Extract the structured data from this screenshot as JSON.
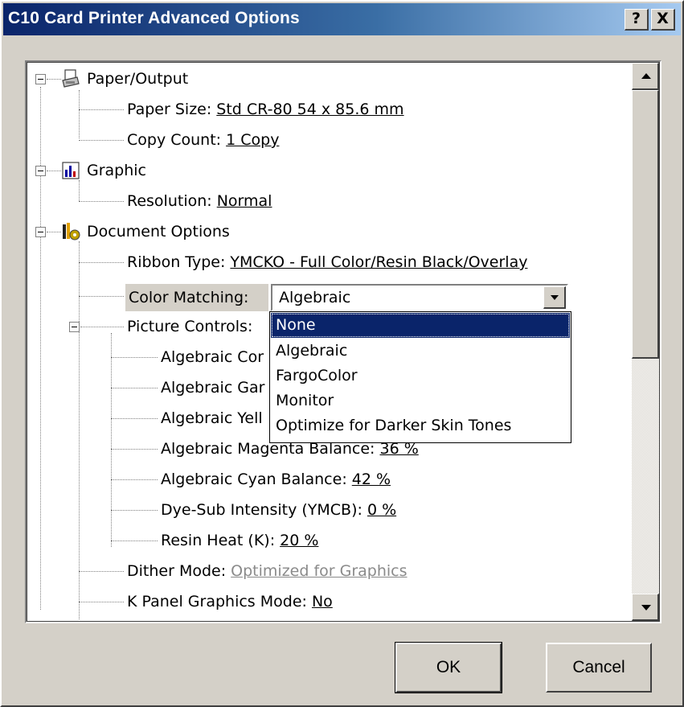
{
  "window": {
    "title": "C10 Card Printer Advanced Options",
    "help_button": "?",
    "close_button": "X"
  },
  "tree": {
    "paper_output": {
      "label": "Paper/Output",
      "paper_size_label": "Paper Size: ",
      "paper_size_value": "Std CR-80  54 x 85.6 mm",
      "copy_count_label": "Copy Count: ",
      "copy_count_value": "1 Copy"
    },
    "graphic": {
      "label": "Graphic",
      "resolution_label": "Resolution: ",
      "resolution_value": "Normal"
    },
    "document_options": {
      "label": "Document Options",
      "ribbon_type_label": "Ribbon Type: ",
      "ribbon_type_value": "YMCKO - Full Color/Resin Black/Overlay",
      "color_matching_label": "Color Matching:",
      "color_matching_value": "Algebraic",
      "color_matching_options": [
        "None",
        "Algebraic",
        "FargoColor",
        "Monitor",
        "Optimize for Darker Skin Tones"
      ],
      "color_matching_highlighted": "None",
      "picture_controls_label": "Picture Controls:",
      "picture_controls": {
        "contrast_label": "Algebraic Cor",
        "gamma_label": "Algebraic Gar",
        "yellow_label": "Algebraic Yell",
        "magenta_label": "Algebraic Magenta Balance: ",
        "magenta_value": "36 %",
        "cyan_label": "Algebraic Cyan Balance: ",
        "cyan_value": "42 %",
        "dyesub_label": "Dye-Sub Intensity (YMCB): ",
        "dyesub_value": "0 %",
        "resin_label": "Resin Heat (K): ",
        "resin_value": "20 %"
      },
      "dither_mode_label": "Dither Mode: ",
      "dither_mode_value": "Optimized for Graphics",
      "k_panel_label": "K Panel Graphics Mode: ",
      "k_panel_value": "No"
    }
  },
  "buttons": {
    "ok": "OK",
    "cancel": "Cancel"
  },
  "colors": {
    "titlebar_start": "#0a246a",
    "titlebar_end": "#a6caf0",
    "highlight": "#0a246a",
    "face": "#d4d0c8",
    "disabled_text": "#8a8a8a"
  }
}
